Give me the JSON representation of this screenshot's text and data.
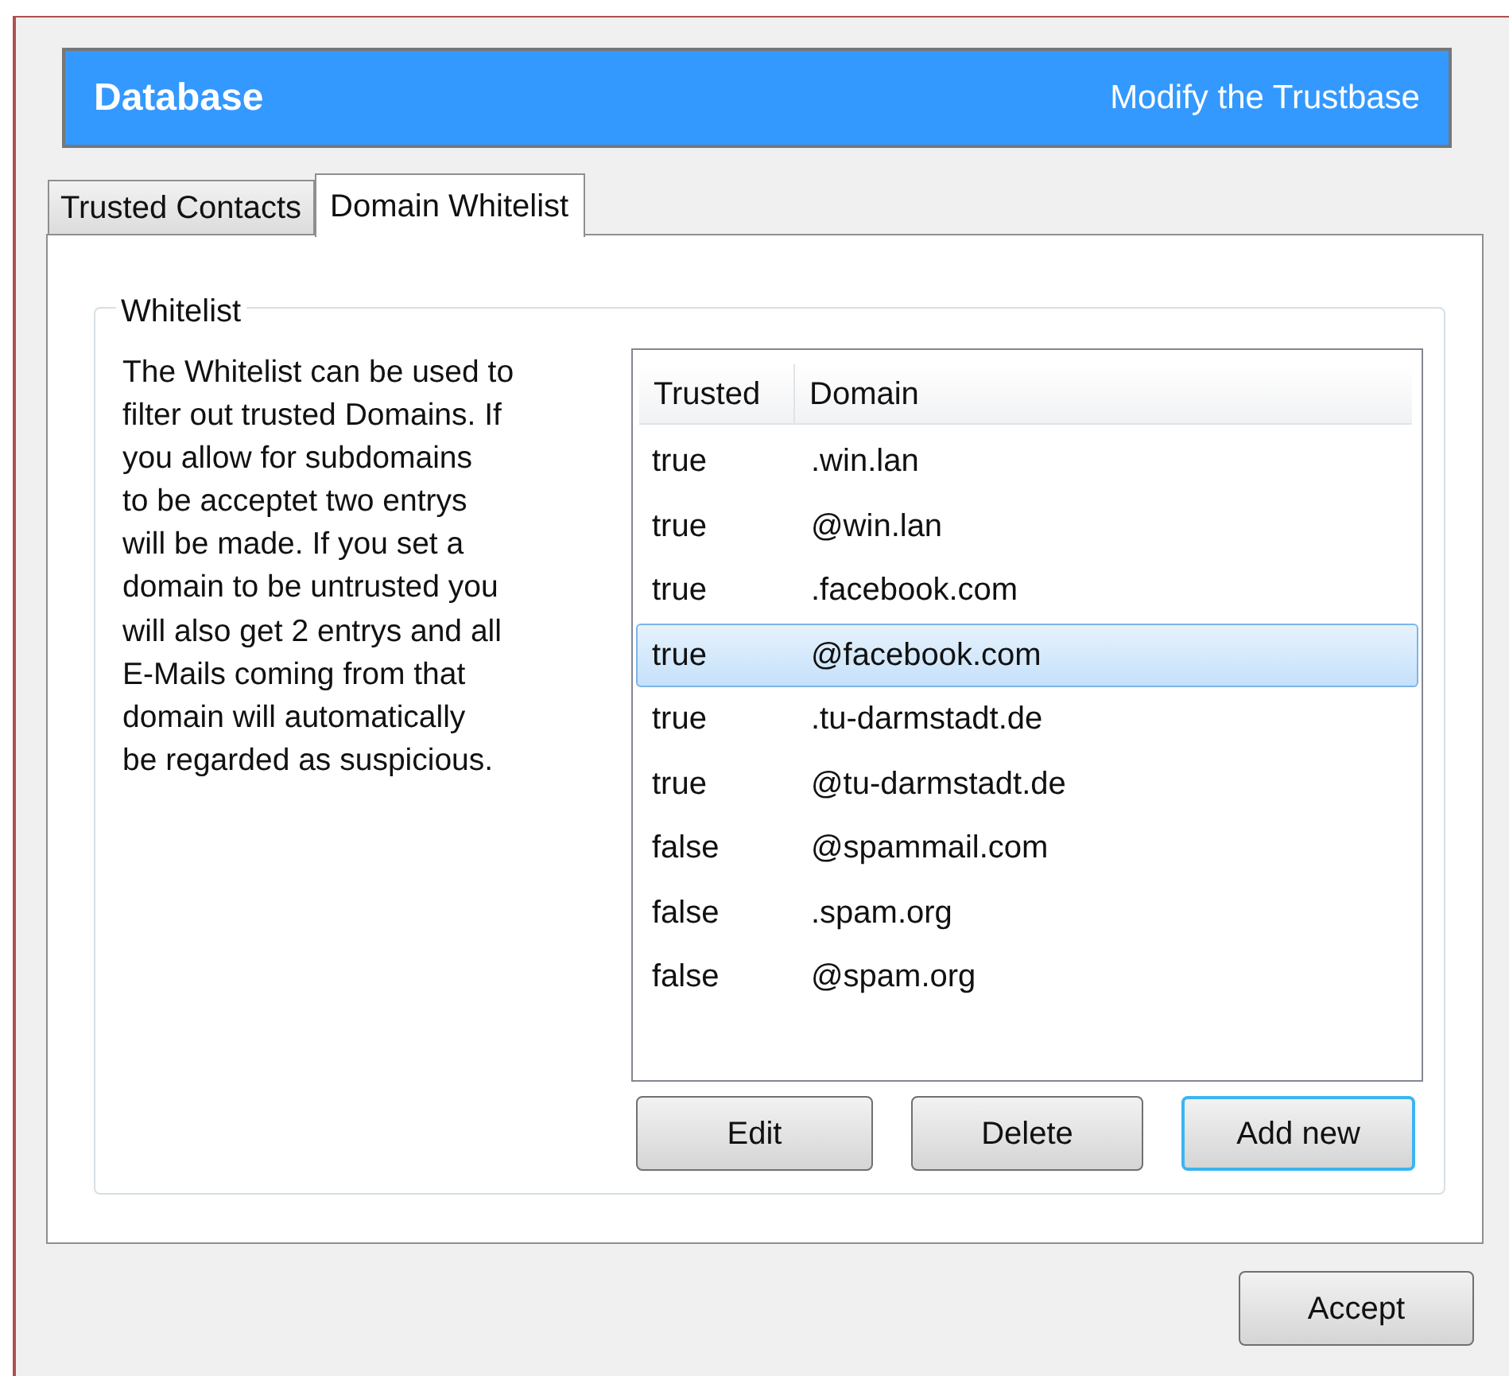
{
  "header": {
    "title": "Database",
    "subtitle": "Modify the Trustbase"
  },
  "tabs": [
    {
      "label": "Trusted Contacts",
      "selected": false
    },
    {
      "label": "Domain Whitelist",
      "selected": true
    }
  ],
  "group": {
    "title": "Whitelist",
    "description_lines": [
      "The Whitelist can be used to",
      "filter out trusted Domains. If",
      "you allow for subdomains",
      "to be acceptet two entrys",
      "will be made. If you set a",
      "domain to be untrusted you",
      "will also get 2 entrys and all",
      "E-Mails coming from that",
      "domain will automatically",
      "be regarded as suspicious."
    ]
  },
  "table": {
    "columns": [
      "Trusted",
      "Domain"
    ],
    "rows": [
      {
        "cells": [
          "true",
          ".win.lan"
        ],
        "selected": false
      },
      {
        "cells": [
          "true",
          "@win.lan"
        ],
        "selected": false
      },
      {
        "cells": [
          "true",
          ".facebook.com"
        ],
        "selected": false
      },
      {
        "cells": [
          "true",
          "@facebook.com"
        ],
        "selected": true
      },
      {
        "cells": [
          "true",
          ".tu-darmstadt.de"
        ],
        "selected": false
      },
      {
        "cells": [
          "true",
          "@tu-darmstadt.de"
        ],
        "selected": false
      },
      {
        "cells": [
          "false",
          "@spammail.com"
        ],
        "selected": false
      },
      {
        "cells": [
          "false",
          ".spam.org"
        ],
        "selected": false
      },
      {
        "cells": [
          "false",
          "@spam.org"
        ],
        "selected": false
      }
    ]
  },
  "buttons": [
    {
      "label": "Edit",
      "focused": false
    },
    {
      "label": "Delete",
      "focused": false
    },
    {
      "label": "Add new",
      "focused": true
    }
  ],
  "footer_buttons": [
    {
      "label": "Accept",
      "focused": false
    }
  ]
}
